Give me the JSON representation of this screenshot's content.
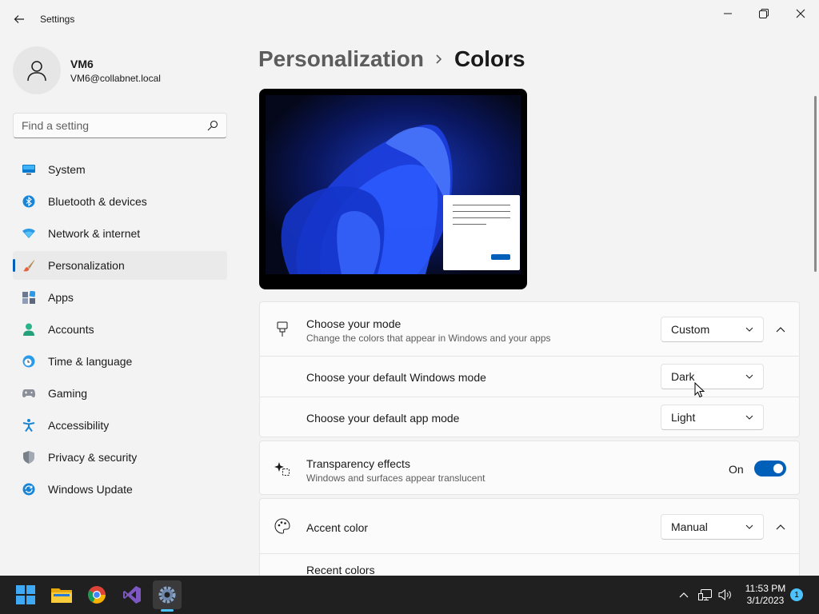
{
  "window": {
    "title": "Settings"
  },
  "user": {
    "name": "VM6",
    "email": "VM6@collabnet.local"
  },
  "search": {
    "placeholder": "Find a setting"
  },
  "sidebar": {
    "items": [
      {
        "label": "System",
        "icon": "monitor-icon",
        "active": false
      },
      {
        "label": "Bluetooth & devices",
        "icon": "bluetooth-icon",
        "active": false
      },
      {
        "label": "Network & internet",
        "icon": "wifi-icon",
        "active": false
      },
      {
        "label": "Personalization",
        "icon": "paintbrush-icon",
        "active": true
      },
      {
        "label": "Apps",
        "icon": "apps-icon",
        "active": false
      },
      {
        "label": "Accounts",
        "icon": "person-icon",
        "active": false
      },
      {
        "label": "Time & language",
        "icon": "clock-globe-icon",
        "active": false
      },
      {
        "label": "Gaming",
        "icon": "gamepad-icon",
        "active": false
      },
      {
        "label": "Accessibility",
        "icon": "accessibility-icon",
        "active": false
      },
      {
        "label": "Privacy & security",
        "icon": "shield-icon",
        "active": false
      },
      {
        "label": "Windows Update",
        "icon": "update-icon",
        "active": false
      }
    ]
  },
  "breadcrumb": {
    "parent": "Personalization",
    "current": "Colors"
  },
  "mode_card": {
    "title": "Choose your mode",
    "description": "Change the colors that appear in Windows and your apps",
    "value": "Custom",
    "windows_mode_label": "Choose your default Windows mode",
    "windows_mode_value": "Dark",
    "app_mode_label": "Choose your default app mode",
    "app_mode_value": "Light"
  },
  "transparency": {
    "title": "Transparency effects",
    "description": "Windows and surfaces appear translucent",
    "state_label": "On",
    "enabled": true
  },
  "accent": {
    "title": "Accent color",
    "value": "Manual",
    "recent_label": "Recent colors"
  },
  "taskbar": {
    "time": "11:53 PM",
    "date": "3/1/2023",
    "notification_count": "1"
  },
  "colors": {
    "accent": "#005fb8",
    "toggle_on": "#005fb8",
    "taskbar": "#202020"
  }
}
